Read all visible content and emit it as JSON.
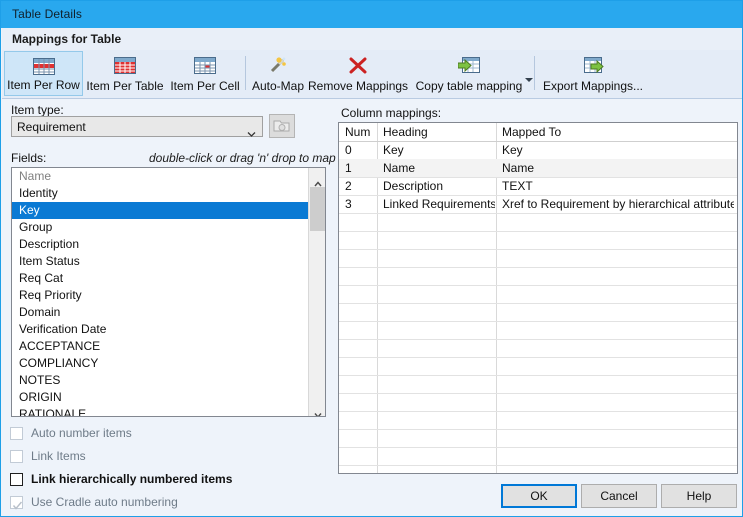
{
  "window": {
    "title": "Table Details",
    "section_heading": "Mappings for Table",
    "accent_color": "#29a8ee",
    "selection_color": "#0a7ad4"
  },
  "toolbar": {
    "buttons": [
      {
        "label": "Item Per Row",
        "icon": "grid-row-icon",
        "active": true
      },
      {
        "label": "Item Per Table",
        "icon": "grid-table-icon",
        "active": false
      },
      {
        "label": "Item Per Cell",
        "icon": "grid-cell-icon",
        "active": false
      },
      {
        "label": "Auto-Map",
        "icon": "magic-wand-icon",
        "active": false
      },
      {
        "label": "Remove Mappings",
        "icon": "red-x-icon",
        "active": false
      },
      {
        "label": "Copy table mapping",
        "icon": "copy-table-icon",
        "active": false
      },
      {
        "label": "Export Mappings...",
        "icon": "export-table-icon",
        "active": false
      }
    ]
  },
  "left": {
    "item_type_label": "Item type:",
    "item_type_value": "Requirement",
    "browse_icon": "folder-tag-icon",
    "fields_label": "Fields:",
    "fields_hint": "double-click or drag 'n' drop to map",
    "fields_header": "Name",
    "fields": [
      "Identity",
      "Key",
      "Group",
      "Description",
      "Item Status",
      "Req Cat",
      "Req Priority",
      "Domain",
      "Verification Date",
      "ACCEPTANCE",
      "COMPLIANCY",
      "NOTES",
      "ORIGIN",
      "RATIONALE"
    ],
    "selected_field": "Key",
    "checkboxes": [
      {
        "label": "Auto number items",
        "checked": false,
        "enabled": false
      },
      {
        "label": "Link Items",
        "checked": false,
        "enabled": false
      },
      {
        "label": "Link hierarchically numbered items",
        "checked": false,
        "enabled": true
      },
      {
        "label": "Use Cradle auto numbering",
        "checked": true,
        "enabled": false
      }
    ]
  },
  "right": {
    "column_mappings_label": "Column mappings:",
    "columns": [
      "Num",
      "Heading",
      "Mapped To"
    ],
    "rows": [
      {
        "num": "0",
        "heading": "Key",
        "mapped_to": "Key",
        "selected": false
      },
      {
        "num": "1",
        "heading": "Name",
        "mapped_to": "Name",
        "selected": true
      },
      {
        "num": "2",
        "heading": "Description",
        "mapped_to": "TEXT",
        "selected": false
      },
      {
        "num": "3",
        "heading": "Linked Requirements",
        "mapped_to": "Xref to Requirement by hierarchical attribute",
        "selected": false
      }
    ],
    "empty_row_count": 15
  },
  "footer": {
    "ok": "OK",
    "cancel": "Cancel",
    "help": "Help"
  }
}
